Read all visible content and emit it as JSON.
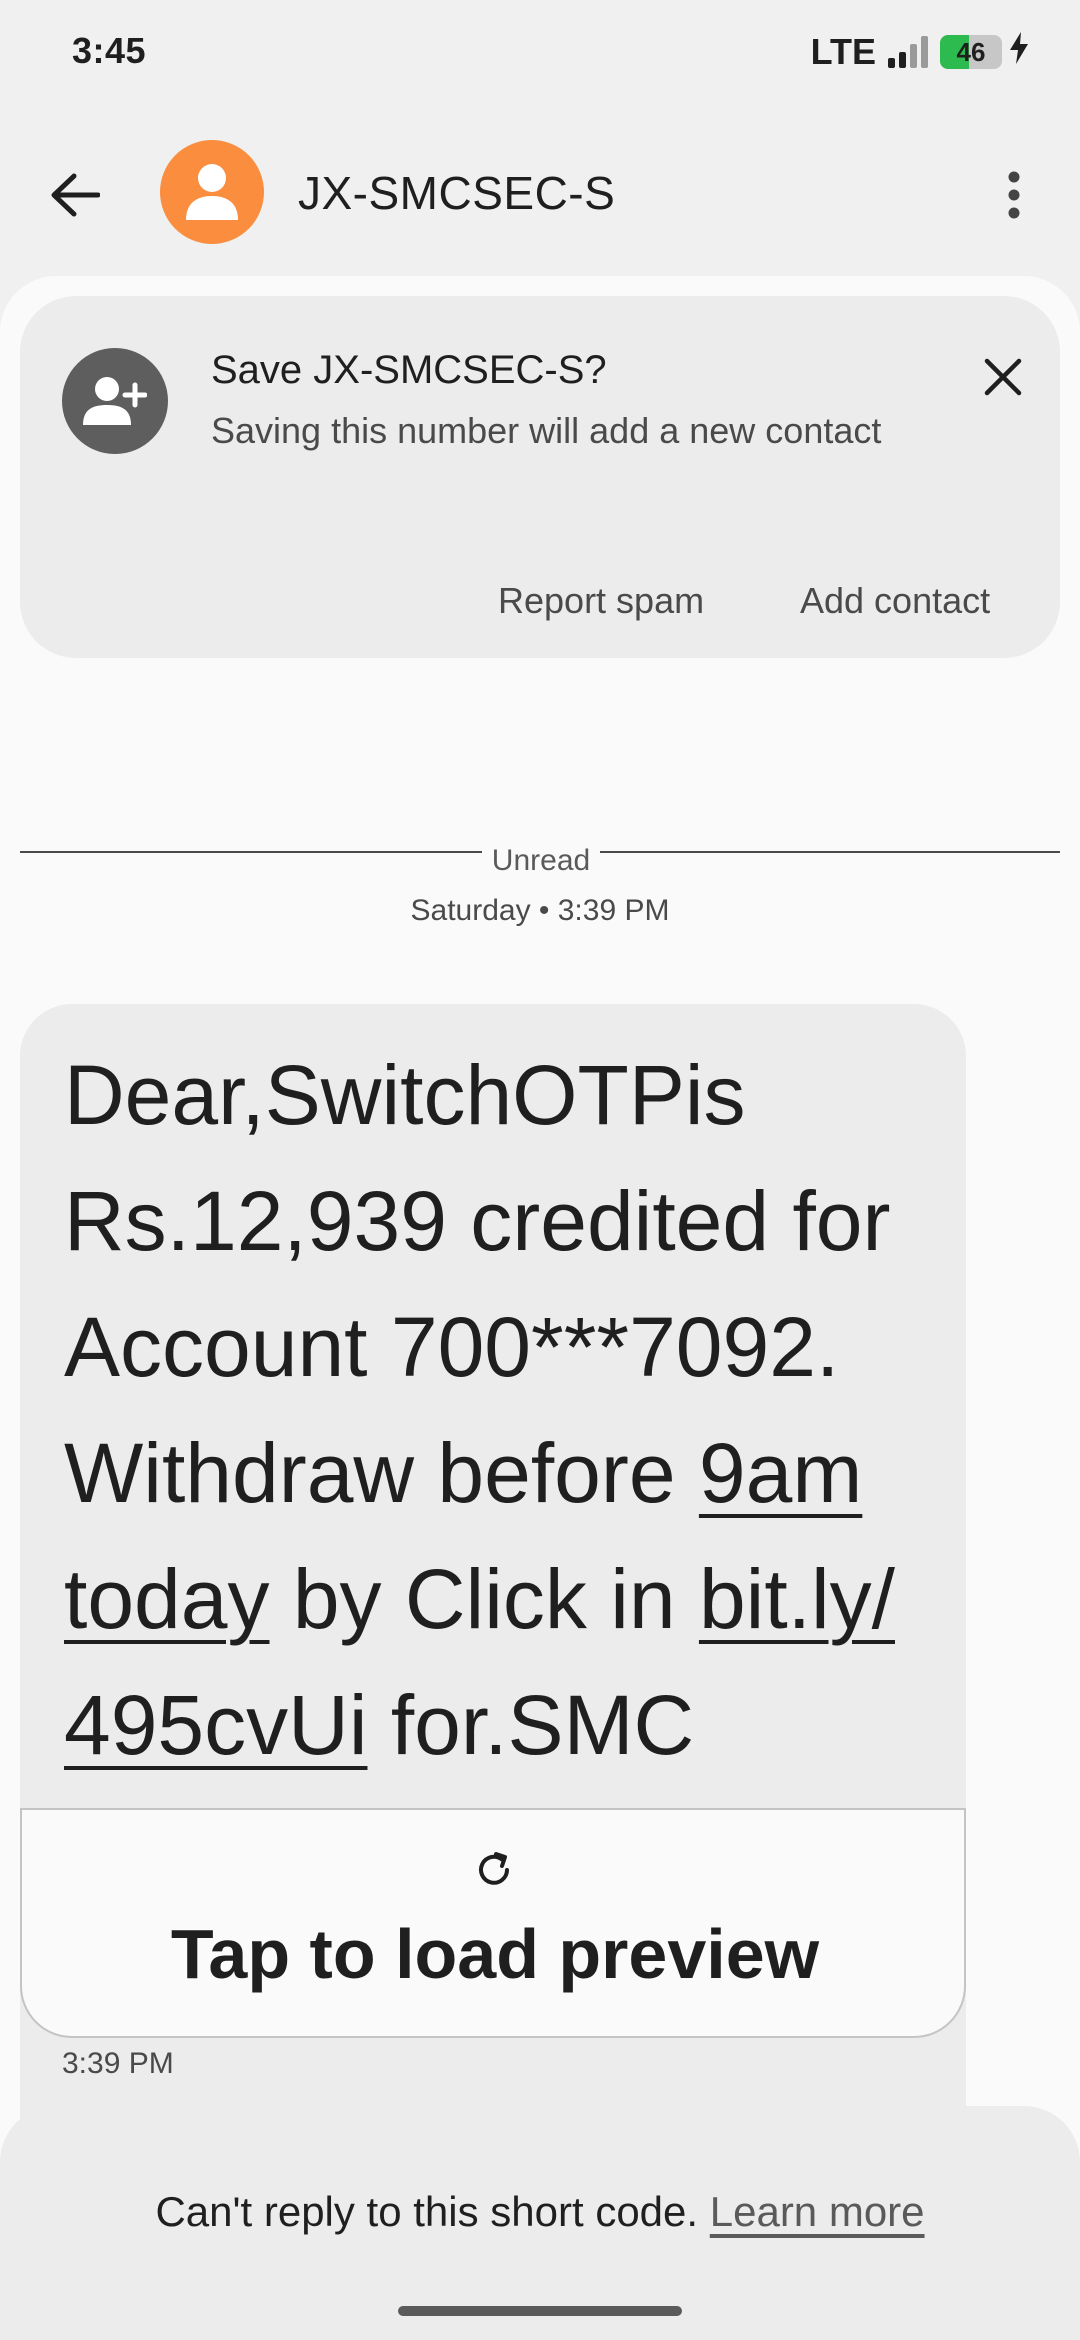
{
  "status_bar": {
    "time": "3:45",
    "network": "LTE",
    "battery_percent": "46",
    "battery_level": 0.46,
    "signal_bars": 2,
    "battery_color": "#2dbb4f"
  },
  "header": {
    "title": "JX-SMCSEC-S",
    "avatar_color": "#fa8d3e",
    "icons": {
      "back": "arrow-left-icon",
      "more": "more-vert-icon",
      "avatar": "person-icon"
    }
  },
  "save_card": {
    "title": "Save JX-SMCSEC-S?",
    "subtitle": "Saving this number will add a new contact",
    "report_spam": "Report spam",
    "add_contact": "Add contact",
    "icons": {
      "lead": "person-add-icon",
      "close": "close-icon"
    }
  },
  "thread": {
    "unread_label": "Unread",
    "date_label": "Saturday • 3:39 PM"
  },
  "message": {
    "text": {
      "part1": "Dear,SwitchOTPis Rs.12,939 credited for Account 700***7092. Withdraw before ",
      "link1": "9am today",
      "part2": " by Click in ",
      "link2": "bit.ly/ 495cvUi",
      "part3": " for.SMC"
    },
    "preview_label": "Tap to load preview",
    "preview_icon": "refresh-icon",
    "time": "3:39 PM"
  },
  "footer": {
    "notice": "Can't reply to this short code.",
    "learn_more": "Learn more"
  }
}
